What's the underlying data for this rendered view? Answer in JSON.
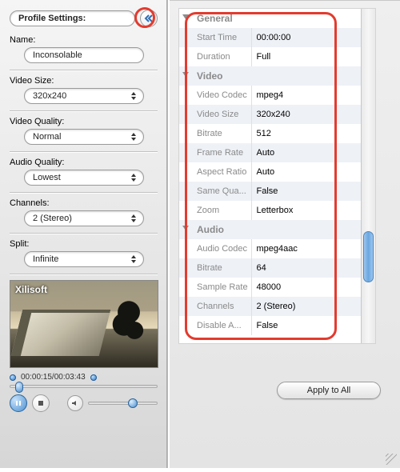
{
  "left": {
    "profile_settings_label": "Profile Settings:",
    "name_label": "Name:",
    "name_value": "Inconsolable",
    "video_size_label": "Video Size:",
    "video_size_value": "320x240",
    "video_quality_label": "Video Quality:",
    "video_quality_value": "Normal",
    "audio_quality_label": "Audio Quality:",
    "audio_quality_value": "Lowest",
    "channels_label": "Channels:",
    "channels_value": "2 (Stereo)",
    "split_label": "Split:",
    "split_value": "Infinite",
    "preview_brand": "Xilisoft",
    "timecode": "00:00:15/00:03:43"
  },
  "props": {
    "sections": {
      "general": "General",
      "video": "Video",
      "audio": "Audio"
    },
    "rows": {
      "start_time_k": "Start Time",
      "start_time_v": "00:00:00",
      "duration_k": "Duration",
      "duration_v": "Full",
      "vcodec_k": "Video Codec",
      "vcodec_v": "mpeg4",
      "vsize_k": "Video Size",
      "vsize_v": "320x240",
      "vbitrate_k": "Bitrate",
      "vbitrate_v": "512",
      "fps_k": "Frame Rate",
      "fps_v": "Auto",
      "aspect_k": "Aspect Ratio",
      "aspect_v": "Auto",
      "sameq_k": "Same Qua...",
      "sameq_v": "False",
      "zoom_k": "Zoom",
      "zoom_v": "Letterbox",
      "acodec_k": "Audio Codec",
      "acodec_v": "mpeg4aac",
      "abitrate_k": "Bitrate",
      "abitrate_v": "64",
      "srate_k": "Sample Rate",
      "srate_v": "48000",
      "ach_k": "Channels",
      "ach_v": "2 (Stereo)",
      "disa_k": "Disable A...",
      "disa_v": "False"
    }
  },
  "apply_label": "Apply to All"
}
